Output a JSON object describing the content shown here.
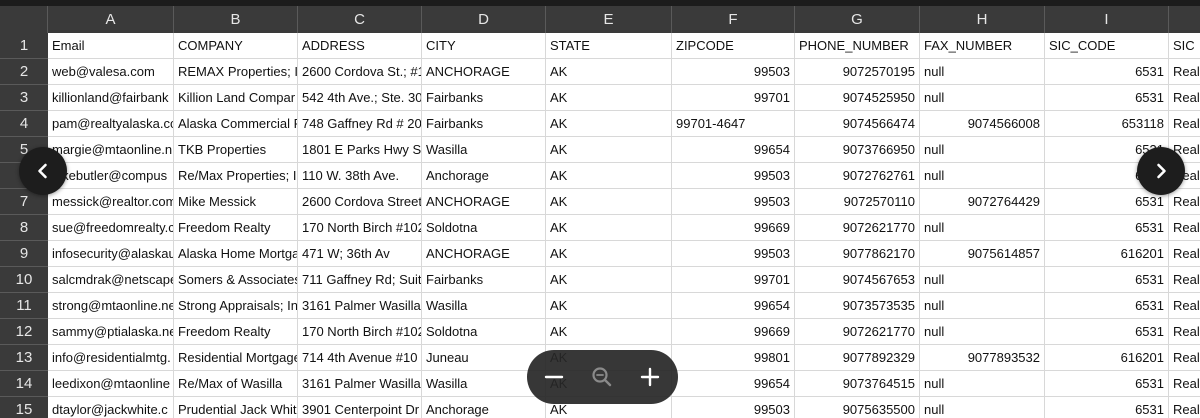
{
  "columns": [
    "A",
    "B",
    "C",
    "D",
    "E",
    "F",
    "G",
    "H",
    "I",
    ""
  ],
  "rows": [
    {
      "n": "1",
      "cells": [
        "Email",
        "COMPANY",
        "ADDRESS",
        "CITY",
        "STATE",
        "ZIPCODE",
        "PHONE_NUMBER",
        "FAX_NUMBER",
        "SIC_CODE",
        "SIC"
      ]
    },
    {
      "n": "2",
      "cells": [
        "web@valesa.com",
        "REMAX Properties; Ir",
        "2600 Cordova St.; #1",
        "ANCHORAGE",
        "AK",
        "99503",
        "9072570195",
        "null",
        "6531",
        "Real"
      ]
    },
    {
      "n": "3",
      "cells": [
        "killionland@fairbank",
        "Killion Land Compar",
        "542 4th Ave.; Ste. 30",
        "Fairbanks",
        "AK",
        "99701",
        "9074525950",
        "null",
        "6531",
        "Real"
      ]
    },
    {
      "n": "4",
      "cells": [
        "pam@realtyalaska.cc",
        "Alaska Commercial F",
        "748 Gaffney Rd # 20",
        "Fairbanks",
        "AK",
        "99701-4647",
        "9074566474",
        "9074566008",
        "653118",
        "Real"
      ]
    },
    {
      "n": "5",
      "cells": [
        "margie@mtaonline.n",
        "TKB Properties",
        "1801 E Parks Hwy St",
        "Wasilla",
        "AK",
        "99654",
        "9073766950",
        "null",
        "6531",
        "Real"
      ]
    },
    {
      "n": "6",
      "cells": [
        "lakebutler@compus",
        "Re/Max Properties; Ir",
        "110 W. 38th Ave.",
        "Anchorage",
        "AK",
        "99503",
        "9072762761",
        "null",
        "6531",
        "Real"
      ]
    },
    {
      "n": "7",
      "cells": [
        "messick@realtor.com",
        "Mike Messick",
        "2600 Cordova Street",
        "ANCHORAGE",
        "AK",
        "99503",
        "9072570110",
        "9072764429",
        "6531",
        "Real"
      ]
    },
    {
      "n": "8",
      "cells": [
        "sue@freedomrealty.c",
        "Freedom Realty",
        "170 North Birch #102",
        "Soldotna",
        "AK",
        "99669",
        "9072621770",
        "null",
        "6531",
        "Real"
      ]
    },
    {
      "n": "9",
      "cells": [
        "infosecurity@alaskau",
        "Alaska Home Mortga",
        "471 W; 36th Av",
        "ANCHORAGE",
        "AK",
        "99503",
        "9077862170",
        "9075614857",
        "616201",
        "Real"
      ]
    },
    {
      "n": "10",
      "cells": [
        "salcmdrak@netscape",
        "Somers & Associates",
        "711 Gaffney Rd; Suit",
        "Fairbanks",
        "AK",
        "99701",
        "9074567653",
        "null",
        "6531",
        "Real"
      ]
    },
    {
      "n": "11",
      "cells": [
        "strong@mtaonline.ne",
        "Strong Appraisals; In",
        "3161 Palmer Wasilla",
        "Wasilla",
        "AK",
        "99654",
        "9073573535",
        "null",
        "6531",
        "Real"
      ]
    },
    {
      "n": "12",
      "cells": [
        "sammy@ptialaska.ne",
        "Freedom Realty",
        "170 North Birch #102",
        "Soldotna",
        "AK",
        "99669",
        "9072621770",
        "null",
        "6531",
        "Real"
      ]
    },
    {
      "n": "13",
      "cells": [
        "info@residentialmtg.",
        "Residential Mortgage",
        "714 4th Avenue #10",
        "Juneau",
        "AK",
        "99801",
        "9077892329",
        "9077893532",
        "616201",
        "Real"
      ]
    },
    {
      "n": "14",
      "cells": [
        "leedixon@mtaonline",
        "Re/Max of Wasilla",
        "3161 Palmer Wasilla",
        "Wasilla",
        "AK",
        "99654",
        "9073764515",
        "null",
        "6531",
        "Real"
      ]
    },
    {
      "n": "15",
      "cells": [
        "dtaylor@jackwhite.c",
        "Prudential Jack Whit",
        "3901 Centerpoint Dr",
        "Anchorage",
        "AK",
        "99503",
        "9075635500",
        "null",
        "6531",
        "Real"
      ]
    }
  ],
  "icons": {
    "prev": "chevron-left-icon",
    "next": "chevron-right-icon",
    "zoom_out": "minus-icon",
    "zoom_reset": "magnifier-icon",
    "zoom_in": "plus-icon"
  },
  "colors": {
    "header_bg": "#3a3a3a",
    "header_text": "#e6e6e6",
    "grid": "#d8d8d8",
    "nav_btn": "#1d1d1d"
  }
}
